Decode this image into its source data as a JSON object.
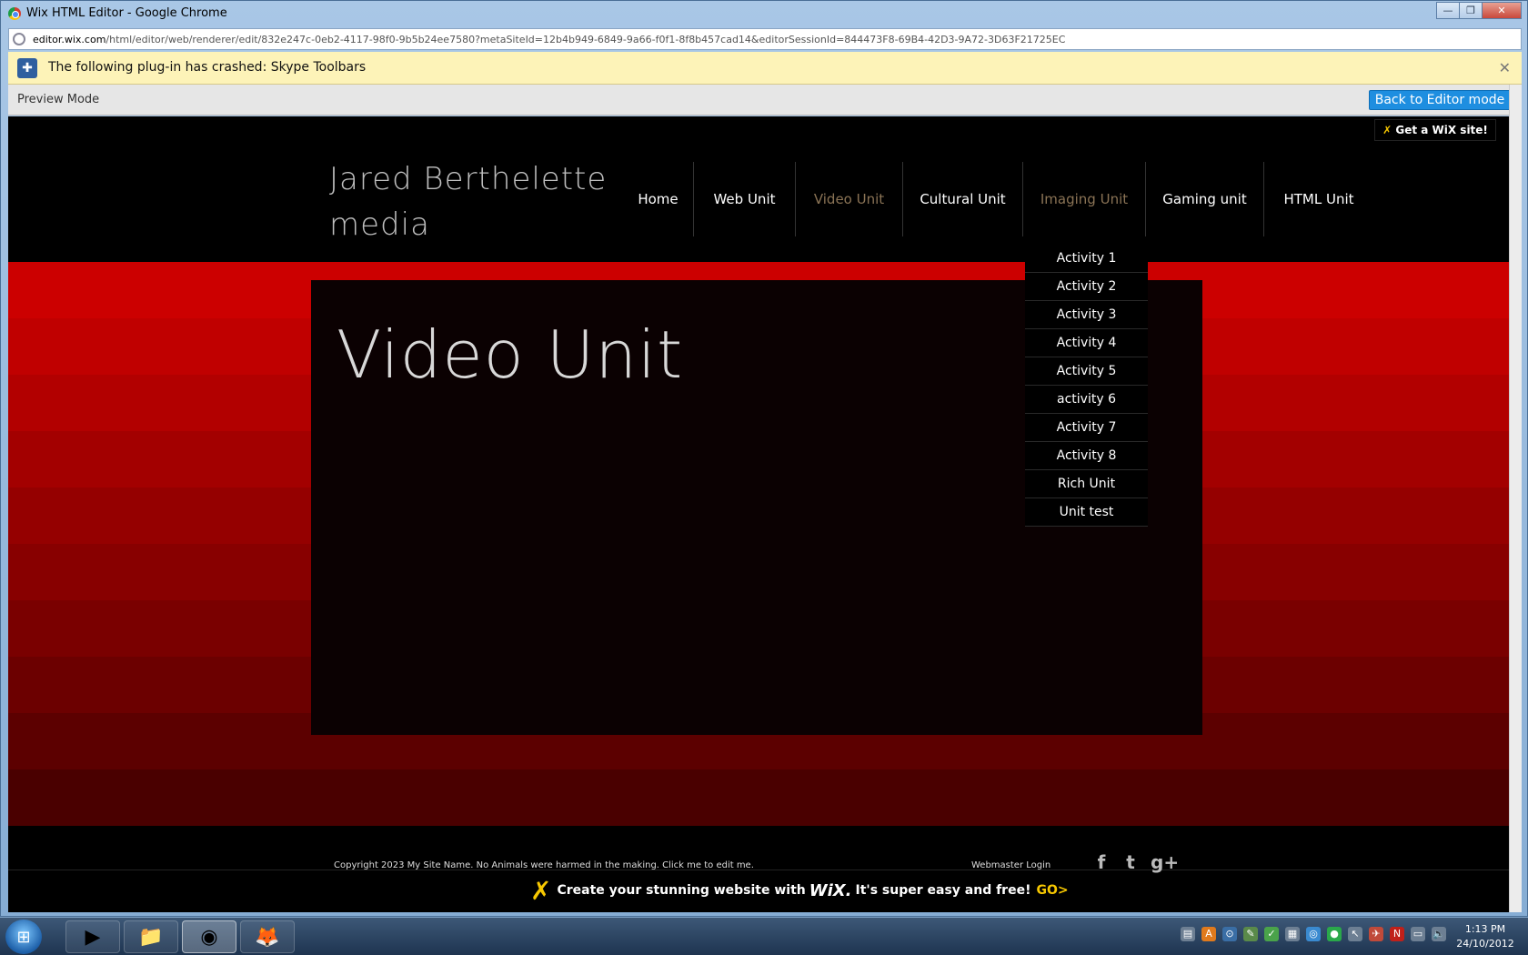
{
  "window": {
    "title": "Wix HTML Editor - Google Chrome",
    "controls": [
      "—",
      "❐",
      "✕"
    ]
  },
  "address": {
    "host": "editor.wix.com",
    "path": "/html/editor/web/renderer/edit/832e247c-0eb2-4117-98f0-9b5b24ee7580?metaSiteId=12b4b949-6849-9a66-f0f1-8f8b457cad14&editorSessionId=844473F8-69B4-42D3-9A72-3D63F21725EC"
  },
  "infobar": {
    "message": "The following plug-in has crashed: Skype Toolbars",
    "close": "✕"
  },
  "preview": {
    "mode_label": "Preview Mode",
    "back_button": "Back to Editor mode"
  },
  "site": {
    "badge": "Get a WiX site!",
    "badge_mark": "✗",
    "logo_line1": "Jared Berthelette",
    "logo_line2": "media",
    "nav": [
      {
        "label": "Home",
        "state": "normal"
      },
      {
        "label": "Web Unit",
        "state": "normal"
      },
      {
        "label": "Video Unit",
        "state": "active"
      },
      {
        "label": "Cultural Unit",
        "state": "normal"
      },
      {
        "label": "Imaging Unit",
        "state": "hover"
      },
      {
        "label": "Gaming unit",
        "state": "normal"
      },
      {
        "label": "HTML Unit",
        "state": "normal"
      }
    ],
    "dropdown": [
      "Activity 1",
      "Activity 2",
      "Activity 3",
      "Activity 4",
      "Activity 5",
      "activity 6",
      "Activity 7",
      "Activity 8",
      "Rich Unit",
      "Unit test"
    ],
    "page_title": "Video Unit",
    "footer": {
      "copyright": "Copyright 2023 My Site Name. No Animals were harmed in the making. Click me to edit me.",
      "webmaster": "Webmaster Login",
      "socials": [
        "f",
        "t",
        "g+"
      ]
    },
    "promo": {
      "mark": "✗",
      "text1": "Create your stunning website with",
      "brand": "WiX.",
      "text2": "It's super easy and free!",
      "go": "GO>"
    },
    "colors": {
      "bands": [
        "#cc0000",
        "#c00000",
        "#b20000",
        "#a30000",
        "#950000",
        "#880000",
        "#7a0000",
        "#6c0000",
        "#5c0000",
        "#4a0000"
      ],
      "accent_nav": "#8a7355",
      "wix_yellow": "#f6c700"
    }
  },
  "taskbar": {
    "start": "⊞",
    "apps": [
      {
        "name": "media-player-icon",
        "glyph": "▶"
      },
      {
        "name": "explorer-icon",
        "glyph": "📁"
      },
      {
        "name": "chrome-icon",
        "glyph": "◉"
      },
      {
        "name": "firefox-icon",
        "glyph": "🦊"
      }
    ],
    "tray": [
      "▤",
      "A",
      "⊙",
      "✎",
      "✓",
      "▦",
      "◎",
      "●",
      "↖",
      "✈",
      "N",
      "▭",
      "🔈"
    ],
    "time": "1:13 PM",
    "date": "24/10/2012"
  }
}
